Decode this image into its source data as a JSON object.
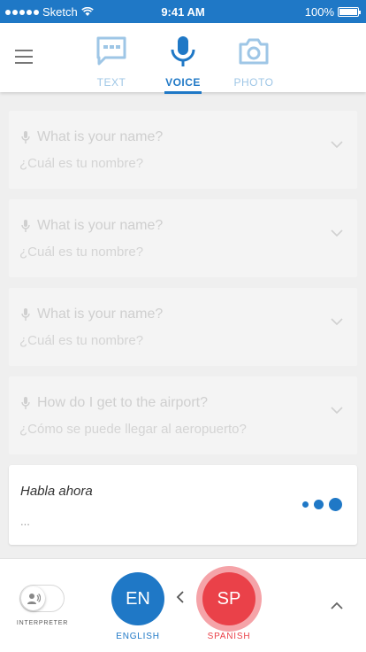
{
  "status_bar": {
    "carrier": "Sketch",
    "time": "9:41 AM",
    "battery": "100%"
  },
  "tabs": [
    {
      "label": "TEXT",
      "icon": "keyboard-icon",
      "active": false
    },
    {
      "label": "VOICE",
      "icon": "microphone-icon",
      "active": true
    },
    {
      "label": "PHOTO",
      "icon": "camera-icon",
      "active": false
    }
  ],
  "conversation": [
    {
      "question": "What is your name?",
      "translation": "¿Cuál es tu nombre?"
    },
    {
      "question": "What is your name?",
      "translation": "¿Cuál es tu nombre?"
    },
    {
      "question": "What is your name?",
      "translation": "¿Cuál es tu nombre?"
    },
    {
      "question": "How do I get to the airport?",
      "translation": "¿Cómo se puede llegar al aeropuerto?"
    }
  ],
  "active_prompt": {
    "title": "Habla ahora",
    "text": "..."
  },
  "bottom_bar": {
    "interpreter_label": "INTERPRETER",
    "source_lang": {
      "code": "EN",
      "label": "ENGLISH"
    },
    "target_lang": {
      "code": "SP",
      "label": "SPANISH"
    }
  },
  "colors": {
    "primary": "#1f78c6",
    "accent": "#ea4149",
    "muted_tab": "#9ec6e6"
  }
}
